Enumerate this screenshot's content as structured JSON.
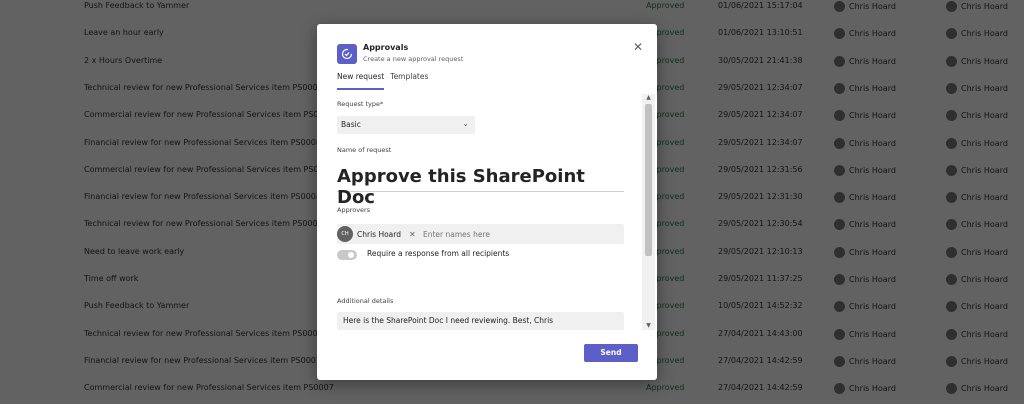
{
  "background_rows": [
    {
      "title": "Push Feedback to Yammer",
      "status": "Approved",
      "date": "01/06/2021 15:17:04",
      "requester": "Chris Hoard",
      "approver": "Chris Hoard"
    },
    {
      "title": "Leave an hour early",
      "status": "Approved",
      "date": "01/06/2021 13:10:51",
      "requester": "Chris Hoard",
      "approver": "Chris Hoard"
    },
    {
      "title": "2 x Hours Overtime",
      "status": "Approved",
      "date": "30/05/2021 21:41:38",
      "requester": "Chris Hoard",
      "approver": "Chris Hoard"
    },
    {
      "title": "Technical review for new Professional Services item PS0008",
      "status": "Approved",
      "date": "29/05/2021 12:34:07",
      "requester": "Chris Hoard",
      "approver": "Chris Hoard"
    },
    {
      "title": "Commercial review for new Professional Services item PS0008",
      "status": "Approved",
      "date": "29/05/2021 12:34:07",
      "requester": "Chris Hoard",
      "approver": "Chris Hoard"
    },
    {
      "title": "Financial review for new Professional Services item PS0008",
      "status": "Approved",
      "date": "29/05/2021 12:34:07",
      "requester": "Chris Hoard",
      "approver": "Chris Hoard"
    },
    {
      "title": "Commercial review for new Professional Services item PS0004",
      "status": "Approved",
      "date": "29/05/2021 12:31:56",
      "requester": "Chris Hoard",
      "approver": "Chris Hoard"
    },
    {
      "title": "Financial review for new Professional Services item PS0004",
      "status": "Approved",
      "date": "29/05/2021 12:31:30",
      "requester": "Chris Hoard",
      "approver": "Chris Hoard"
    },
    {
      "title": "Technical review for new Professional Services item PS0004",
      "status": "Approved",
      "date": "29/05/2021 12:30:54",
      "requester": "Chris Hoard",
      "approver": "Chris Hoard"
    },
    {
      "title": "Need to leave work early",
      "status": "Approved",
      "date": "29/05/2021 12:10:13",
      "requester": "Chris Hoard",
      "approver": "Chris Hoard"
    },
    {
      "title": "Time off work",
      "status": "Approved",
      "date": "29/05/2021 11:37:25",
      "requester": "Chris Hoard",
      "approver": "Chris Hoard"
    },
    {
      "title": "Push Feedback to Yammer",
      "status": "Approved",
      "date": "10/05/2021 14:52:32",
      "requester": "Chris Hoard",
      "approver": "Chris Hoard"
    },
    {
      "title": "Technical review for new Professional Services item PS0007",
      "status": "Approved",
      "date": "27/04/2021 14:43:00",
      "requester": "Chris Hoard",
      "approver": "Chris Hoard"
    },
    {
      "title": "Financial review for new Professional Services item PS0007",
      "status": "Approved",
      "date": "27/04/2021 14:42:59",
      "requester": "Chris Hoard",
      "approver": "Chris Hoard"
    },
    {
      "title": "Commercial review for new Professional Services item PS0007",
      "status": "Approved",
      "date": "27/04/2021 14:42:59",
      "requester": "Chris Hoard",
      "approver": "Chris Hoard"
    }
  ],
  "dialog": {
    "app_name": "Approvals",
    "app_subtitle": "Create a new approval request",
    "close_icon": "close-icon",
    "tabs": [
      {
        "label": "New request",
        "active": true
      },
      {
        "label": "Templates",
        "active": false
      }
    ],
    "request_type_label": "Request type*",
    "request_type_value": "Basic",
    "name_label": "Name of request",
    "name_value": "Approve this SharePoint Doc",
    "approvers_label": "Approvers",
    "approver_chip": {
      "initials": "CH",
      "name": "Chris Hoard"
    },
    "approvers_placeholder": "Enter names here",
    "require_response_label": "Require a response from all recipients",
    "require_response_on": false,
    "details_label": "Additional details",
    "details_value": "Here is the SharePoint Doc I need reviewing. Best, Chris",
    "send_label": "Send"
  },
  "colors": {
    "accent": "#5b5fc7",
    "approved": "#237b4b"
  }
}
